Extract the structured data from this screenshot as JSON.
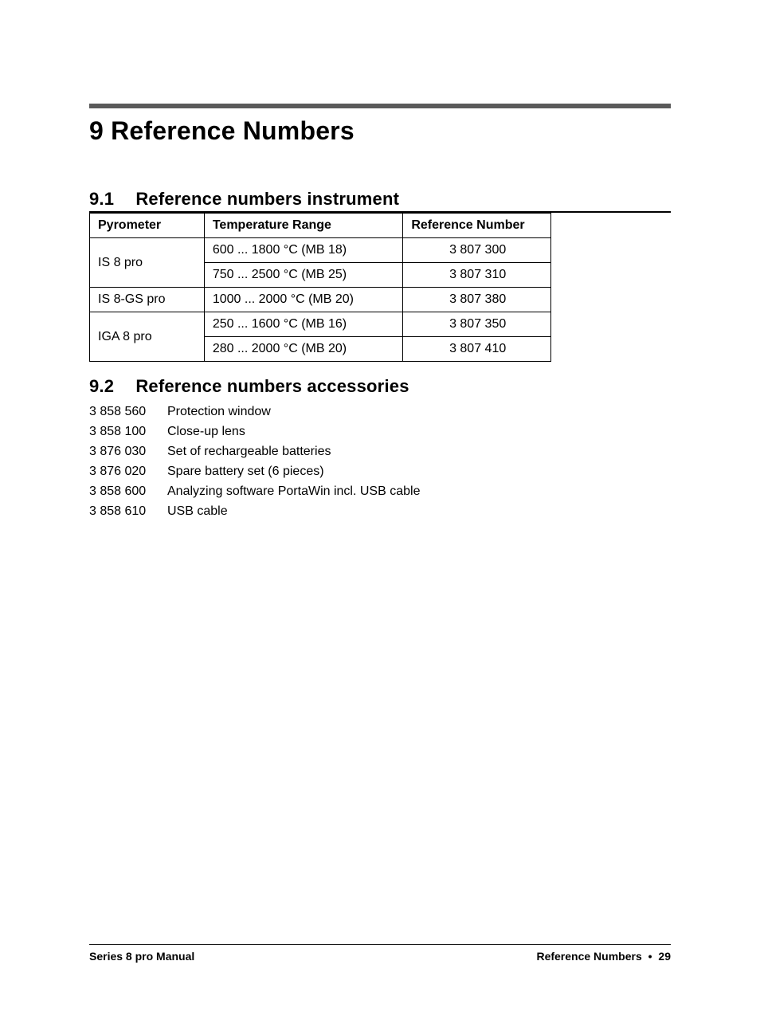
{
  "chapter": {
    "number": "9",
    "title": "Reference Numbers"
  },
  "section91": {
    "number": "9.1",
    "title": "Reference numbers instrument",
    "headers": {
      "pyrometer": "Pyrometer",
      "temp_range": "Temperature Range",
      "ref_num": "Reference Number"
    },
    "rows": [
      {
        "pyrometer": "IS 8 pro",
        "temp": "600 ... 1800 °C (MB 18)",
        "ref": "3 807 300",
        "rowspan": 2
      },
      {
        "pyrometer": "",
        "temp": "750 ... 2500 °C (MB 25)",
        "ref": "3 807 310",
        "rowspan": 0
      },
      {
        "pyrometer": "IS 8-GS pro",
        "temp": "1000 ... 2000 °C (MB 20)",
        "ref": "3 807 380",
        "rowspan": 1
      },
      {
        "pyrometer": "IGA 8 pro",
        "temp": "250 ... 1600 °C (MB 16)",
        "ref": "3 807 350",
        "rowspan": 2
      },
      {
        "pyrometer": "",
        "temp": "280 ... 2000 °C (MB 20)",
        "ref": "3 807 410",
        "rowspan": 0
      }
    ]
  },
  "section92": {
    "number": "9.2",
    "title": "Reference numbers accessories",
    "items": [
      {
        "ref": "3 858 560",
        "desc": "Protection window"
      },
      {
        "ref": "3 858 100",
        "desc": "Close-up lens"
      },
      {
        "ref": "3 876 030",
        "desc": "Set of rechargeable batteries"
      },
      {
        "ref": "3 876 020",
        "desc": "Spare battery set (6 pieces)"
      },
      {
        "ref": "3 858 600",
        "desc": "Analyzing software PortaWin incl. USB cable"
      },
      {
        "ref": "3 858 610",
        "desc": "USB cable"
      }
    ]
  },
  "footer": {
    "left": "Series 8 pro Manual",
    "right_section": "Reference Numbers",
    "separator": "•",
    "page": "29"
  }
}
